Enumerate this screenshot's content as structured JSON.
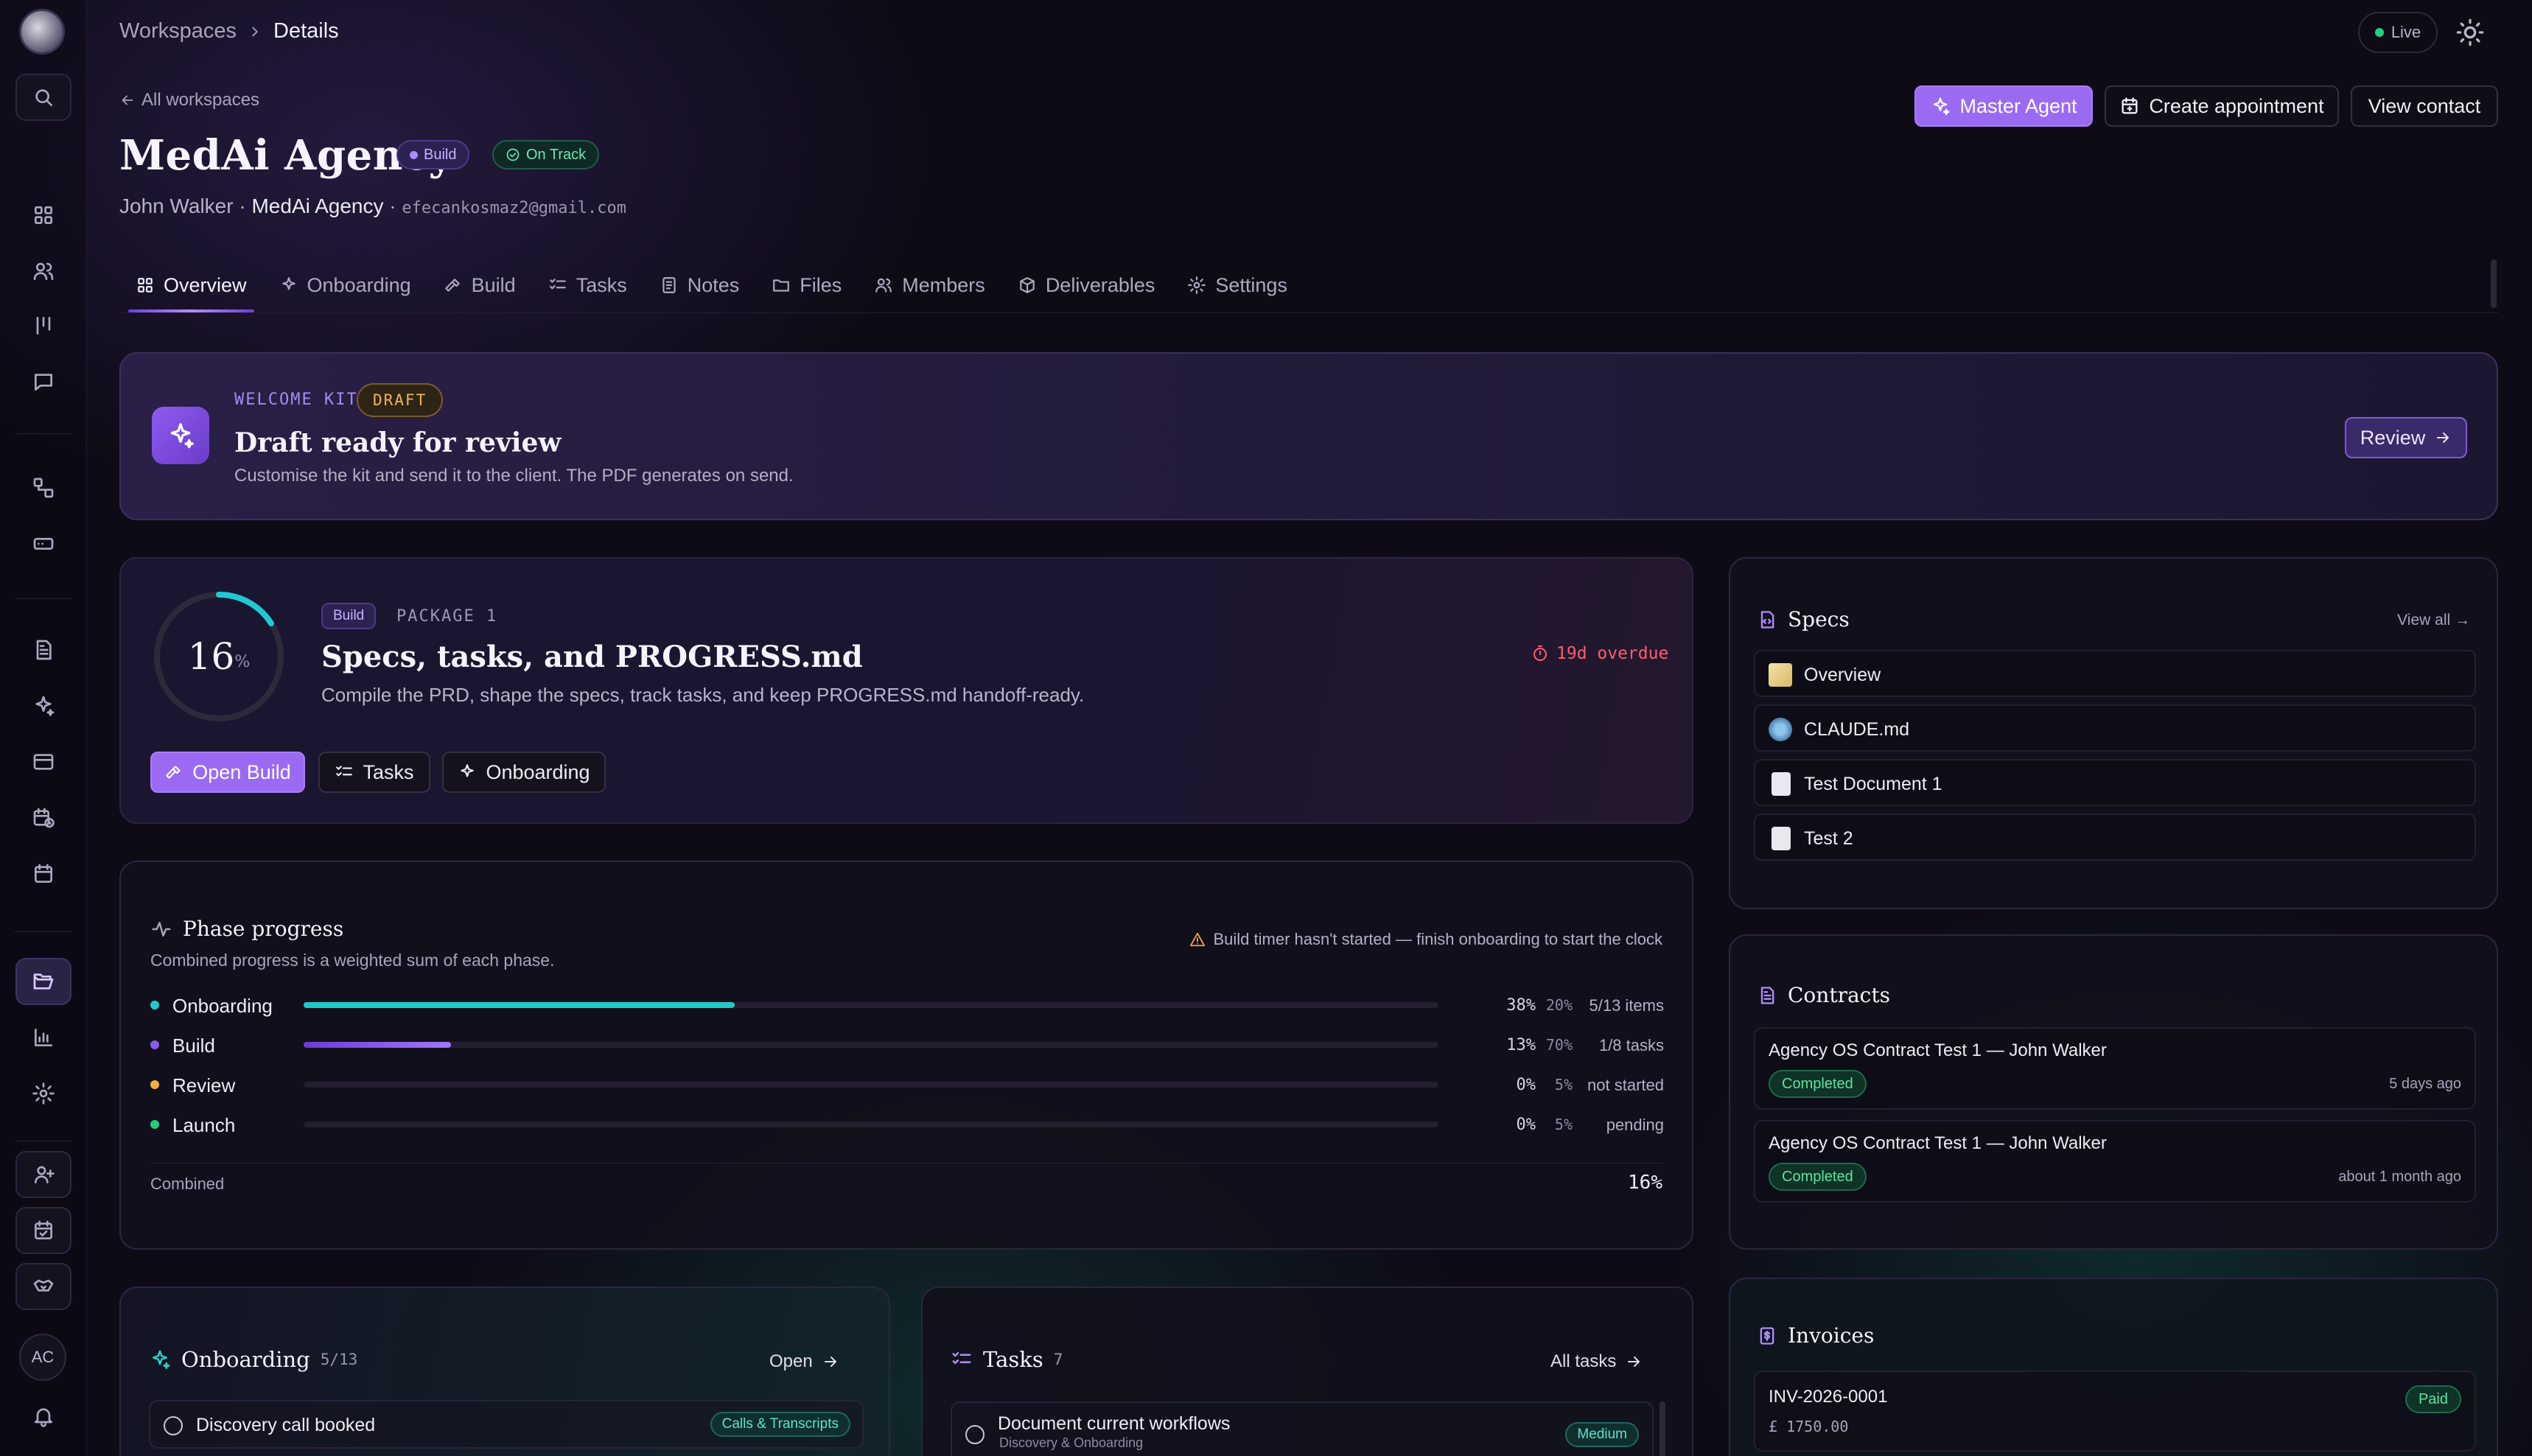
{
  "breadcrumb": {
    "parent": "Workspaces",
    "current": "Details"
  },
  "status": {
    "live_label": "Live"
  },
  "header": {
    "back_label": "All workspaces",
    "title": "MedAi Agency",
    "badge_build": "Build",
    "badge_status": "On Track",
    "contact_name": "John Walker",
    "agency_name": "MedAi Agency",
    "email": "efecankosmaz2@gmail.com",
    "separator": "·"
  },
  "actions": {
    "master_agent": "Master Agent",
    "create_appointment": "Create appointment",
    "view_contact": "View contact"
  },
  "tabs": [
    {
      "label": "Overview",
      "icon": "grid-icon",
      "active": true
    },
    {
      "label": "Onboarding",
      "icon": "sparkles-icon"
    },
    {
      "label": "Build",
      "icon": "hammer-icon"
    },
    {
      "label": "Tasks",
      "icon": "list-checks-icon"
    },
    {
      "label": "Notes",
      "icon": "note-icon"
    },
    {
      "label": "Files",
      "icon": "folder-icon"
    },
    {
      "label": "Members",
      "icon": "users-icon"
    },
    {
      "label": "Deliverables",
      "icon": "package-icon"
    },
    {
      "label": "Settings",
      "icon": "gear-icon"
    }
  ],
  "welcome_kit": {
    "eyebrow": "WELCOME KIT",
    "badge": "DRAFT",
    "title": "Draft ready for review",
    "description": "Customise the kit and send it to the client. The PDF generates on send.",
    "review_label": "Review"
  },
  "package": {
    "progress_value": "16",
    "progress_unit": "%",
    "progress_fraction": 0.16,
    "phase_badge": "Build",
    "package_label": "PACKAGE 1",
    "title": "Specs, tasks, and PROGRESS.md",
    "description": "Compile the PRD, shape the specs, track tasks, and keep PROGRESS.md handoff-ready.",
    "overdue": "19d overdue",
    "buttons": {
      "open_build": "Open Build",
      "tasks": "Tasks",
      "onboarding": "Onboarding"
    }
  },
  "phase_progress": {
    "title": "Phase progress",
    "description": "Combined progress is a weighted sum of each phase.",
    "warning": "Build timer hasn't started — finish onboarding to start the clock",
    "phases": [
      {
        "name": "Onboarding",
        "percent": "38%",
        "weight": "20%",
        "detail": "5/13 items",
        "fraction": 0.38,
        "color": "#1fc9c9"
      },
      {
        "name": "Build",
        "percent": "13%",
        "weight": "70%",
        "detail": "1/8 tasks",
        "fraction": 0.13,
        "color": "#8a5cf0"
      },
      {
        "name": "Review",
        "percent": "0%",
        "weight": "5%",
        "detail": "not started",
        "fraction": 0,
        "color": "#f0b03a"
      },
      {
        "name": "Launch",
        "percent": "0%",
        "weight": "5%",
        "detail": "pending",
        "fraction": 0,
        "color": "#1fd07a"
      }
    ],
    "combined_label": "Combined",
    "combined_value": "16%"
  },
  "onboarding_card": {
    "title": "Onboarding",
    "count": "5/13",
    "open_label": "Open",
    "items": [
      {
        "label": "Discovery call booked",
        "tag": "Calls & Transcripts"
      }
    ]
  },
  "tasks_card": {
    "title": "Tasks",
    "count": "7",
    "all_label": "All tasks",
    "items": [
      {
        "label": "Document current workflows",
        "sub": "Discovery & Onboarding",
        "priority": "Medium"
      }
    ]
  },
  "specs": {
    "title": "Specs",
    "view_all": "View all →",
    "items": [
      {
        "label": "Overview",
        "icon": "memo-icon"
      },
      {
        "label": "CLAUDE.md",
        "icon": "robot-icon"
      },
      {
        "label": "Test Document 1",
        "icon": "page-icon"
      },
      {
        "label": "Test 2",
        "icon": "page-icon"
      }
    ]
  },
  "contracts": {
    "title": "Contracts",
    "items": [
      {
        "title": "Agency OS Contract Test 1 — John Walker",
        "status": "Completed",
        "time": "5 days ago"
      },
      {
        "title": "Agency OS Contract Test 1 — John Walker",
        "status": "Completed",
        "time": "about 1 month ago"
      }
    ]
  },
  "invoices": {
    "title": "Invoices",
    "items": [
      {
        "number": "INV-2026-0001",
        "amount": "£ 1750.00",
        "status": "Paid"
      }
    ]
  },
  "sidebar": {
    "avatar_initials": "AC"
  },
  "colors": {
    "accent": "#9a6bf2",
    "teal": "#1fc9c9",
    "overdue": "#ff5d6c",
    "success": "#5ee2a0"
  }
}
